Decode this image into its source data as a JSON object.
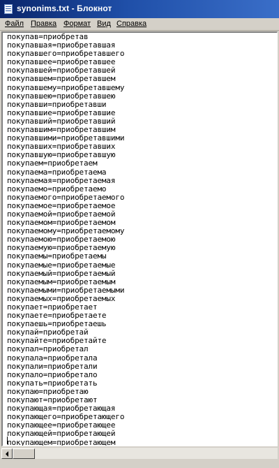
{
  "window": {
    "title": "synonims.txt - Блокнот",
    "icon": "notepad-icon"
  },
  "menu": {
    "file": "Файл",
    "edit": "Правка",
    "format": "Формат",
    "view": "Вид",
    "help": "Справка"
  },
  "editor": {
    "lines": [
      "покупав=приобретав",
      "покупавшая=приобретавшая",
      "покупавшего=приобретавшего",
      "покупавшее=приобретавшее",
      "покупавшей=приобретавшей",
      "покупавшем=приобретавшем",
      "покупавшему=приобретавшему",
      "покупавшею=приобретавшею",
      "покупавши=приобретавши",
      "покупавшие=приобретавшие",
      "покупавший=приобретавший",
      "покупавшим=приобретавшим",
      "покупавшими=приобретавшими",
      "покупавших=приобретавших",
      "покупавшую=приобретавшую",
      "покупаем=приобретаем",
      "покупаема=приобретаема",
      "покупаемая=приобретаемая",
      "покупаемо=приобретаемо",
      "покупаемого=приобретаемого",
      "покупаемое=приобретаемое",
      "покупаемой=приобретаемой",
      "покупаемом=приобретаемом",
      "покупаемому=приобретаемому",
      "покупаемою=приобретаемою",
      "покупаемую=приобретаемую",
      "покупаемы=приобретаемы",
      "покупаемые=приобретаемые",
      "покупаемый=приобретаемый",
      "покупаемым=приобретаемым",
      "покупаемыми=приобретаемыми",
      "покупаемых=приобретаемых",
      "покупает=приобретает",
      "покупаете=приобретаете",
      "покупаешь=приобретаешь",
      "покупай=приобретай",
      "покупайте=приобретайте",
      "покупал=приобретал",
      "покупала=приобретала",
      "покупали=приобретали",
      "покупало=приобретало",
      "покупать=приобретать",
      "покупаю=приобретаю",
      "покупают=приобретают",
      "покупающая=приобретающая",
      "покупающего=приобретающего",
      "покупающее=приобретающее",
      "покупающей=приобретающей",
      "покупающем=приобретающем"
    ]
  }
}
